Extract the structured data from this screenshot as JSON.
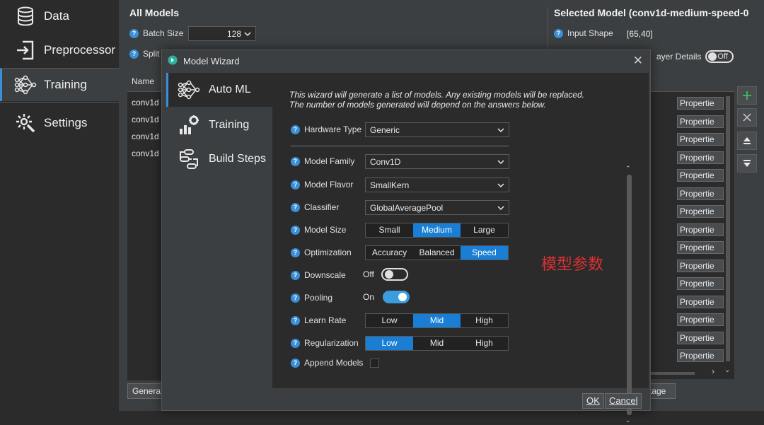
{
  "nav": {
    "items": [
      {
        "label": "Data",
        "icon": "database-icon"
      },
      {
        "label": "Preprocessor",
        "icon": "import-icon"
      },
      {
        "label": "Training",
        "icon": "neural-network-icon"
      },
      {
        "label": "Settings",
        "icon": "gear-icon"
      }
    ],
    "active": "Training"
  },
  "all_models": {
    "title": "All Models",
    "batch_size_label": "Batch Size",
    "batch_size_value": "128",
    "split_label": "Split",
    "table_header": "Name",
    "rows": [
      "conv1d",
      "conv1d",
      "conv1d",
      "conv1d"
    ],
    "generate_button": "Genera"
  },
  "selected_model": {
    "title": "Selected Model (conv1d-medium-speed-0",
    "input_shape_label": "Input Shape",
    "input_shape_value": "[65,40]",
    "layer_details_label": "ayer Details",
    "layer_details_toggle": "Off",
    "properties_label": "Propertie",
    "properties_count": 15,
    "stage_button": "tage"
  },
  "dialog": {
    "title": "Model Wizard",
    "tabs": [
      {
        "label": "Auto ML",
        "icon": "neural-network-icon"
      },
      {
        "label": "Training",
        "icon": "training-chart-icon"
      },
      {
        "label": "Build Steps",
        "icon": "build-steps-icon"
      }
    ],
    "intro_line1": "This wizard will generate a list of models. Any existing models will be replaced.",
    "intro_line2": "The number of models generated will depend on the answers below.",
    "hardware_type": {
      "label": "Hardware Type",
      "value": "Generic"
    },
    "model_family": {
      "label": "Model Family",
      "value": "Conv1D"
    },
    "model_flavor": {
      "label": "Model Flavor",
      "value": "SmallKern"
    },
    "classifier": {
      "label": "Classifier",
      "value": "GlobalAveragePool"
    },
    "model_size": {
      "label": "Model Size",
      "options": [
        "Small",
        "Medium",
        "Large"
      ],
      "selected": "Medium"
    },
    "optimization": {
      "label": "Optimization",
      "options": [
        "Accuracy",
        "Balanced",
        "Speed"
      ],
      "selected": "Speed"
    },
    "downscale": {
      "label": "Downscale",
      "state": "Off"
    },
    "pooling": {
      "label": "Pooling",
      "state": "On"
    },
    "learn_rate": {
      "label": "Learn Rate",
      "options": [
        "Low",
        "Mid",
        "High"
      ],
      "selected": "Mid"
    },
    "regularization": {
      "label": "Regularization",
      "options": [
        "Low",
        "Mid",
        "High"
      ],
      "selected": "Low"
    },
    "append_models": {
      "label": "Append Models",
      "checked": false
    },
    "ok_button": "OK",
    "cancel_button": "Cancel"
  },
  "annotation": "模型参数",
  "colors": {
    "accent": "#1a7fd4",
    "annotation": "#e03030",
    "background": "#2b2b2b",
    "panel": "#3c3f41"
  }
}
